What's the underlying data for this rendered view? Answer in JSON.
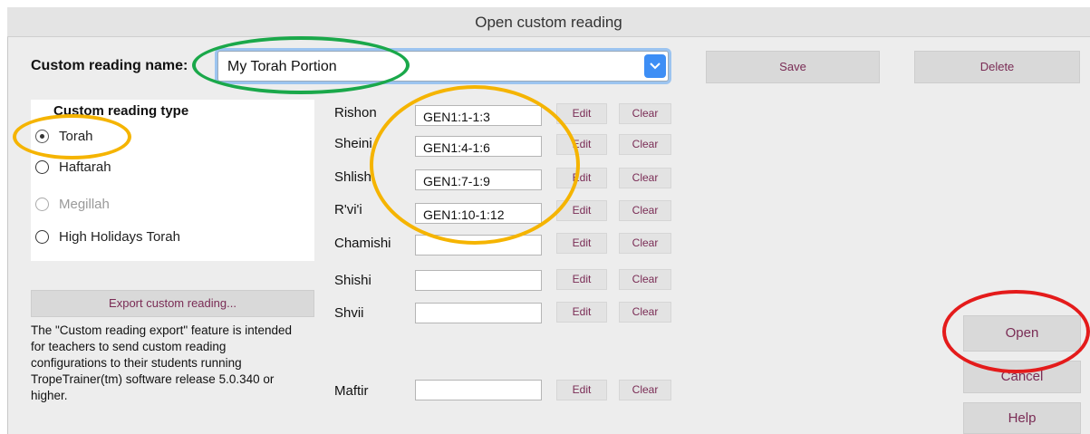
{
  "window": {
    "title": "Open custom reading"
  },
  "name_row": {
    "label": "Custom reading name:",
    "value": "My Torah Portion"
  },
  "toolbar": {
    "save_label": "Save",
    "delete_label": "Delete"
  },
  "reading_type": {
    "heading": "Custom reading type",
    "options": [
      {
        "label": "Torah",
        "selected": true,
        "enabled": true
      },
      {
        "label": "Haftarah",
        "selected": false,
        "enabled": true
      },
      {
        "label": "Megillah",
        "selected": false,
        "enabled": false
      },
      {
        "label": "High Holidays Torah",
        "selected": false,
        "enabled": true
      }
    ]
  },
  "aliyot": [
    {
      "label": "Rishon",
      "value": "GEN1:1-1:3",
      "edit": "Edit",
      "clear": "Clear"
    },
    {
      "label": "Sheini",
      "value": "GEN1:4-1:6",
      "edit": "Edit",
      "clear": "Clear"
    },
    {
      "label": "Shlishi",
      "value": "GEN1:7-1:9",
      "edit": "Edit",
      "clear": "Clear"
    },
    {
      "label": "R'vi'i",
      "value": "GEN1:10-1:12",
      "edit": "Edit",
      "clear": "Clear"
    },
    {
      "label": "Chamishi",
      "value": "",
      "edit": "Edit",
      "clear": "Clear"
    },
    {
      "label": "Shishi",
      "value": "",
      "edit": "Edit",
      "clear": "Clear"
    },
    {
      "label": "Shvii",
      "value": "",
      "edit": "Edit",
      "clear": "Clear"
    },
    {
      "label": "Maftir",
      "value": "",
      "edit": "Edit",
      "clear": "Clear"
    }
  ],
  "export": {
    "button_label": "Export custom reading...",
    "description": "The \"Custom reading export\" feature is intended for teachers to send custom reading configurations to their students running TropeTrainer(tm) software release 5.0.340 or higher."
  },
  "actions": {
    "open_label": "Open",
    "cancel_label": "Cancel",
    "help_label": "Help"
  },
  "colors": {
    "accent": "#3d8ef5",
    "annotation_green": "#1aa84a",
    "annotation_yellow": "#f5b400",
    "annotation_red": "#e41b1b",
    "button_text": "#7a2c55"
  }
}
